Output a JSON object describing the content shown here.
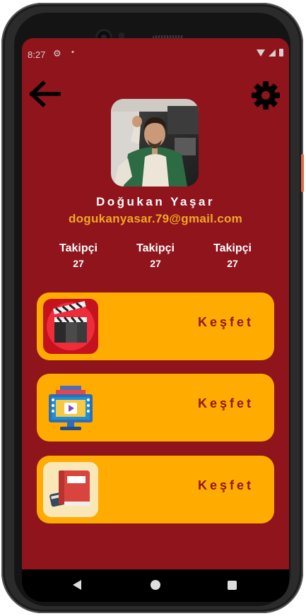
{
  "status_bar": {
    "time": "8:27",
    "icons": [
      "settings-gear-icon",
      "notification-dot-icon",
      "wifi-icon",
      "cell-signal-icon",
      "battery-icon"
    ]
  },
  "header": {
    "back_icon": "arrow-left-icon",
    "settings_icon": "gear-icon"
  },
  "profile": {
    "name": "Doğukan Yaşar",
    "email": "dogukanyasar.79@gmail.com",
    "avatar": "profile-photo"
  },
  "stats": [
    {
      "label": "Takipçi",
      "value": "27"
    },
    {
      "label": "Takipçi",
      "value": "27"
    },
    {
      "label": "Takipçi",
      "value": "27"
    }
  ],
  "cards": [
    {
      "icon": "clapperboard-icon",
      "label": "Keşfet"
    },
    {
      "icon": "tv-play-icon",
      "label": "Keşfet"
    },
    {
      "icon": "books-icon",
      "label": "Keşfet"
    }
  ],
  "colors": {
    "background": "#8f141c",
    "card": "#ffab00",
    "email": "#f2a91f",
    "card_text": "#8f141c"
  },
  "nav_bar": {
    "icons": [
      "nav-back-icon",
      "nav-home-icon",
      "nav-recents-icon"
    ]
  }
}
